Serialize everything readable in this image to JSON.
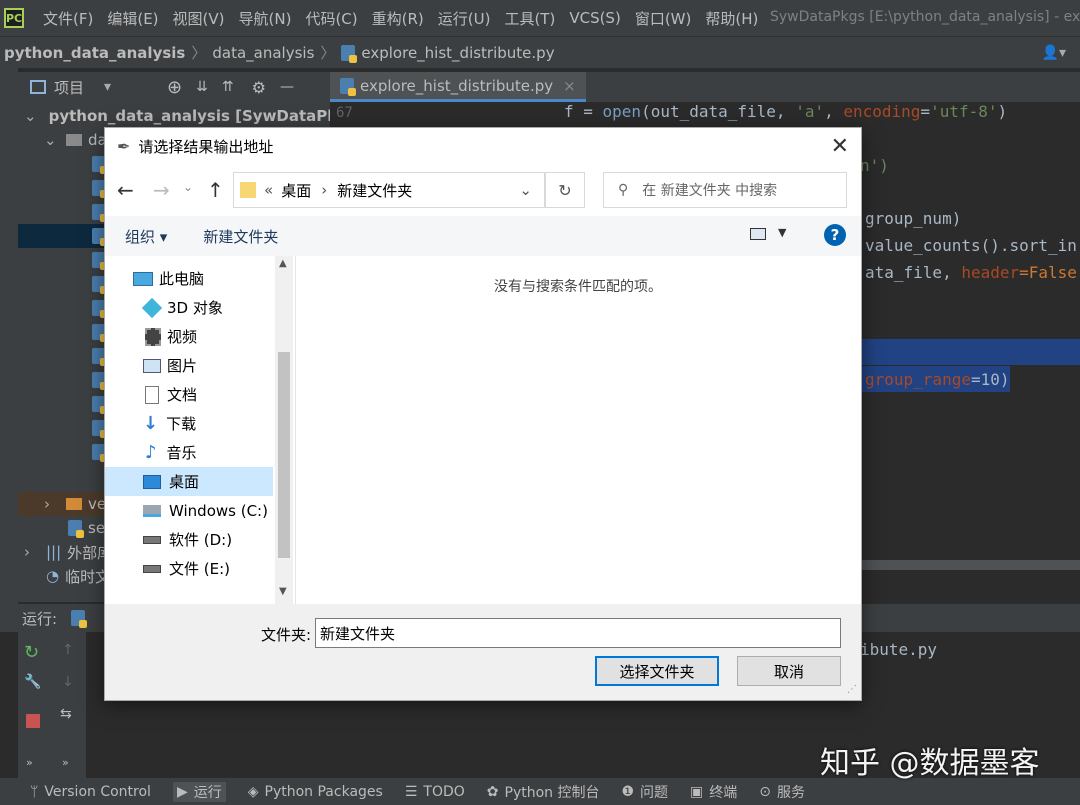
{
  "menubar": {
    "items": [
      "文件(F)",
      "编辑(E)",
      "视图(V)",
      "导航(N)",
      "代码(C)",
      "重构(R)",
      "运行(U)",
      "工具(T)",
      "VCS(S)",
      "窗口(W)",
      "帮助(H)"
    ],
    "window_title": "SywDataPkgs [E:\\python_data_analysis] - exp"
  },
  "breadcrumb": {
    "project": "python_data_analysis",
    "folder": "data_analysis",
    "file": "explore_hist_distribute.py"
  },
  "project_panel": {
    "title": "项目",
    "root_label": "python_data_analysis [SywDataPkgs",
    "sub_label": "da",
    "folder_ve": "ve",
    "file_se": "se",
    "external_libs": "外部库",
    "scratches": "临时文"
  },
  "editor": {
    "tab_label": "explore_hist_distribute.py",
    "line_number": "67",
    "lines": {
      "l1_pre": "f = ",
      "l1_fn": "open",
      "l1_args": "(out_data_file, ",
      "l1_s1": "'a'",
      "l1_mid": ", ",
      "l1_kw": "encoding",
      "l1_eq": "=",
      "l1_s2": "'utf-8'",
      "l1_end": ")",
      "l2": "n')",
      "l3": "group_num)",
      "l4": "value_counts().sort_in",
      "l5_a": "ata_file, ",
      "l5_kw": "header",
      "l5_b": "=False",
      "l6_kw": "group_range",
      "l6_b": "=10)"
    }
  },
  "run_panel": {
    "label": "运行:",
    "output_tail": "ibute.py"
  },
  "statusbar": {
    "items": [
      "Version Control",
      "运行",
      "Python Packages",
      "TODO",
      "Python 控制台",
      "问题",
      "终端",
      "服务"
    ]
  },
  "dialog": {
    "title": "请选择结果输出地址",
    "address": {
      "prefix": "«",
      "part1": "桌面",
      "part2": "新建文件夹"
    },
    "search_placeholder": "在 新建文件夹 中搜索",
    "organize_label": "组织 ▾",
    "new_folder_label": "新建文件夹",
    "nav_items": [
      "此电脑",
      "3D 对象",
      "视频",
      "图片",
      "文档",
      "下载",
      "音乐",
      "桌面",
      "Windows (C:)",
      "软件 (D:)",
      "文件 (E:)"
    ],
    "empty_message": "没有与搜索条件匹配的项。",
    "folder_label": "文件夹:",
    "folder_value": "新建文件夹",
    "select_button": "选择文件夹",
    "cancel_button": "取消"
  },
  "watermark": "知乎 @数据墨客",
  "colors": {
    "ide_bg": "#2b2b2b",
    "panel_bg": "#3c3f41",
    "selection": "#214283",
    "keyword_orange": "#cc7832",
    "string_green": "#6a8759",
    "function_blue": "#7a9ec2",
    "param_purple": "#aa4926",
    "accent_blue": "#0078d7"
  }
}
